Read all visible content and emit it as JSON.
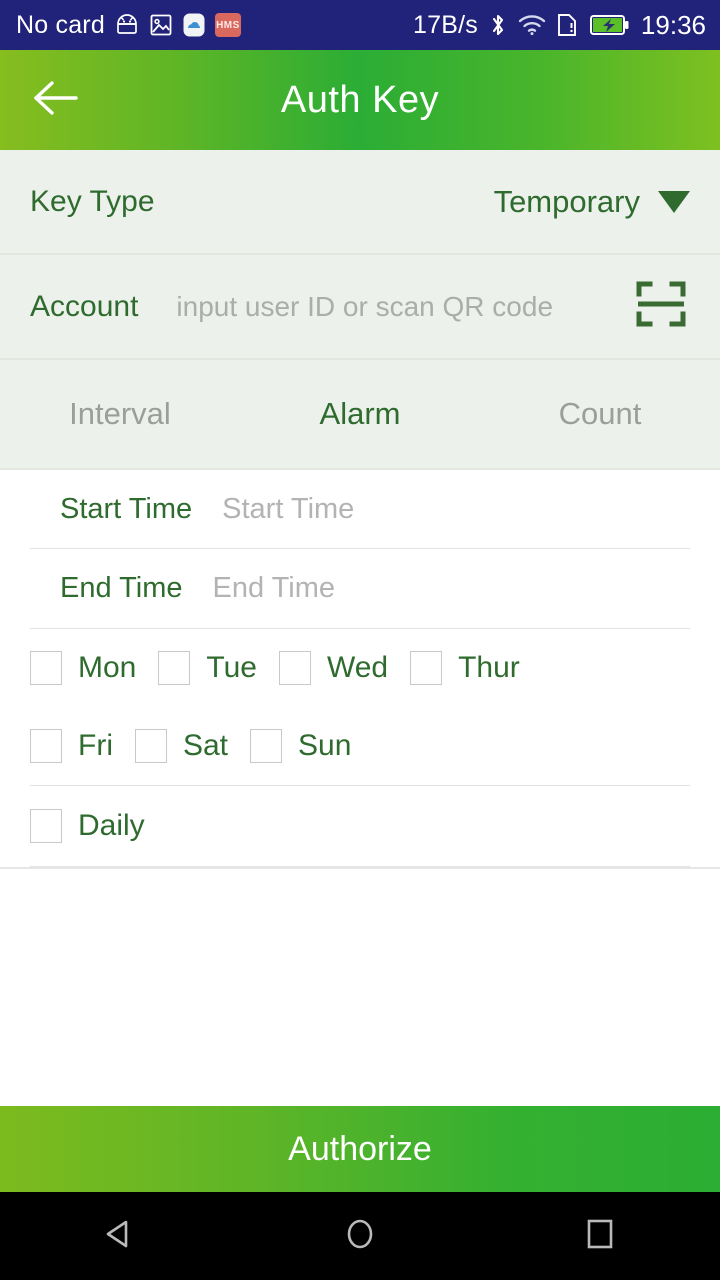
{
  "statusbar": {
    "carrier": "No card",
    "netspeed": "17B/s",
    "time": "19:36",
    "icons": {
      "android": "android-robot-icon",
      "gallery": "gallery-icon",
      "cloud_app": "cloud-app-icon",
      "hms": "HMS",
      "bluetooth": "bluetooth-icon",
      "wifi": "wifi-icon",
      "sim_alert": "sim-card-alert-icon",
      "battery": "battery-charging-icon"
    },
    "bg_color": "#21227a"
  },
  "header": {
    "title": "Auth Key",
    "back_icon": "arrow-left-icon",
    "gradient_from": "#86bd1f",
    "gradient_to": "#2bad35"
  },
  "key_type": {
    "label": "Key Type",
    "value": "Temporary",
    "caret_icon": "chevron-down-icon"
  },
  "account": {
    "label": "Account",
    "value": "",
    "placeholder": "input user ID or scan QR code",
    "scan_icon": "qr-scan-icon"
  },
  "tabs": [
    {
      "label": "Interval",
      "active": false
    },
    {
      "label": "Alarm",
      "active": true
    },
    {
      "label": "Count",
      "active": false
    }
  ],
  "form": {
    "start_time": {
      "label": "Start Time",
      "value": "",
      "placeholder": "Start Time"
    },
    "end_time": {
      "label": "End Time",
      "value": "",
      "placeholder": "End Time"
    },
    "days_row1": [
      {
        "label": "Mon",
        "checked": false
      },
      {
        "label": "Tue",
        "checked": false
      },
      {
        "label": "Wed",
        "checked": false
      },
      {
        "label": "Thur",
        "checked": false
      }
    ],
    "days_row2": [
      {
        "label": "Fri",
        "checked": false
      },
      {
        "label": "Sat",
        "checked": false
      },
      {
        "label": "Sun",
        "checked": false
      }
    ],
    "daily": {
      "label": "Daily",
      "checked": false
    }
  },
  "footer": {
    "authorize_label": "Authorize"
  },
  "navbar": {
    "back": "nav-back-icon",
    "home": "nav-home-icon",
    "recents": "nav-recents-icon"
  },
  "colors": {
    "accent_green": "#2f6b2f",
    "brand_green": "#2bad35",
    "section_bg": "#ecf1eb",
    "placeholder_gray": "#a9aeab"
  }
}
